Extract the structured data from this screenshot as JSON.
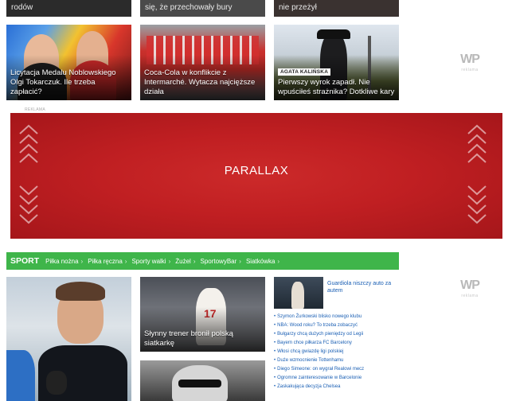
{
  "top_strip": [
    "rodów",
    "się, że przechowały bury",
    "nie przeżył"
  ],
  "cards_row1": [
    {
      "caption": "Licytacja Medalu Noblowskiego Olgi Tokarczuk. Ile trzeba zapłacić?"
    },
    {
      "caption": "Coca-Cola w konflikcie z Intermarché. Wytacza najcięższe działa"
    },
    {
      "badge": "AGATA KALIŃSKA",
      "caption": "Pierwszy wyrok zapadł. Nie wpuściłeś strażnika? Dotkliwe kary"
    }
  ],
  "wp_logo": {
    "text": "WP",
    "sub": "reklama"
  },
  "ad_label": "REKLAMA",
  "parallax": {
    "label": "PARALLAX",
    "color": "#c01f22"
  },
  "sport": {
    "title": "SPORT",
    "color": "#3fb54a",
    "links": [
      "Piłka nożna",
      "Piłka ręczna",
      "Sporty walki",
      "Żużel",
      "SportowyBar",
      "Siatkówka"
    ],
    "arrow": "›"
  },
  "volley_card": {
    "caption": "Słynny trener bronił polską siatkarkę",
    "number": "17"
  },
  "side_story": {
    "title": "Guardiola niszczy auto za autem"
  },
  "news_list": [
    "Szymon Żurkowski blisko nowego klubu",
    "NBA: Wood roku? To trzeba zobaczyć",
    "Bułgarzy chcą dużych pieniędzy od Legii",
    "Bayern chce piłkarza FC Barcelony",
    "Włosi chcą gwiazdę ligi polskiej",
    "Duże wzmocnienie Tottenhamu",
    "Diego Simeone: on wygrał Realowi mecz",
    "Ogromne zainteresowanie w Barcelonie",
    "Zaskakująca decyzja Chelsea"
  ]
}
